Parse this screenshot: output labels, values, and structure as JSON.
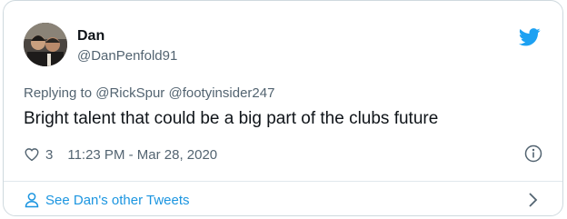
{
  "tweet": {
    "author": {
      "name": "Dan",
      "handle": "@DanPenfold91"
    },
    "reply_prefix": "Replying to ",
    "reply_to": [
      "@RickSpur",
      "@footyinsider247"
    ],
    "text": "Bright talent that could be a big part of the clubs future",
    "likes": "3",
    "timestamp": "11:23 PM - Mar 28, 2020"
  },
  "footer": {
    "more_tweets_label": "See Dan's other Tweets"
  },
  "icons": {
    "brand": "twitter-bird-icon",
    "like": "heart-icon",
    "info": "info-icon",
    "person": "person-icon",
    "chevron": "chevron-right-icon"
  },
  "colors": {
    "accent": "#1da1f2",
    "link": "#1b95e0",
    "text": "#0f1419",
    "muted": "#536471"
  }
}
